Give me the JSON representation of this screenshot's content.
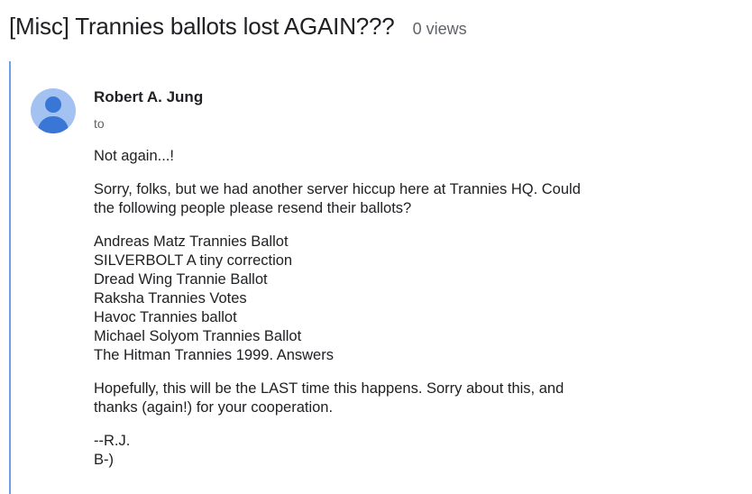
{
  "thread": {
    "title": "[Misc] Trannies ballots lost AGAIN???",
    "views": "0 views"
  },
  "message": {
    "author": "Robert A. Jung",
    "to_label": "to",
    "avatar_icon": "person-icon",
    "greeting": "Not again...!",
    "intro_lines": [
      "Sorry, folks, but we had another server hiccup here at Trannies HQ. Could",
      "the following people please resend their ballots?"
    ],
    "ballot_list": [
      "Andreas Matz Trannies Ballot",
      "SILVERBOLT A tiny correction",
      "Dread Wing Trannie Ballot",
      "Raksha Trannies Votes",
      "Havoc Trannies ballot",
      "Michael Solyom Trannies Ballot",
      "The Hitman Trannies 1999. Answers"
    ],
    "closing_lines": [
      "Hopefully, this will be the LAST time this happens. Sorry about this, and",
      "thanks (again!) for your cooperation."
    ],
    "signature_lines": [
      "--R.J.",
      "B-)"
    ]
  },
  "colors": {
    "accent_border": "#6f9fe6",
    "avatar_bg": "#a3c2f2",
    "avatar_fg": "#3a76d6"
  }
}
